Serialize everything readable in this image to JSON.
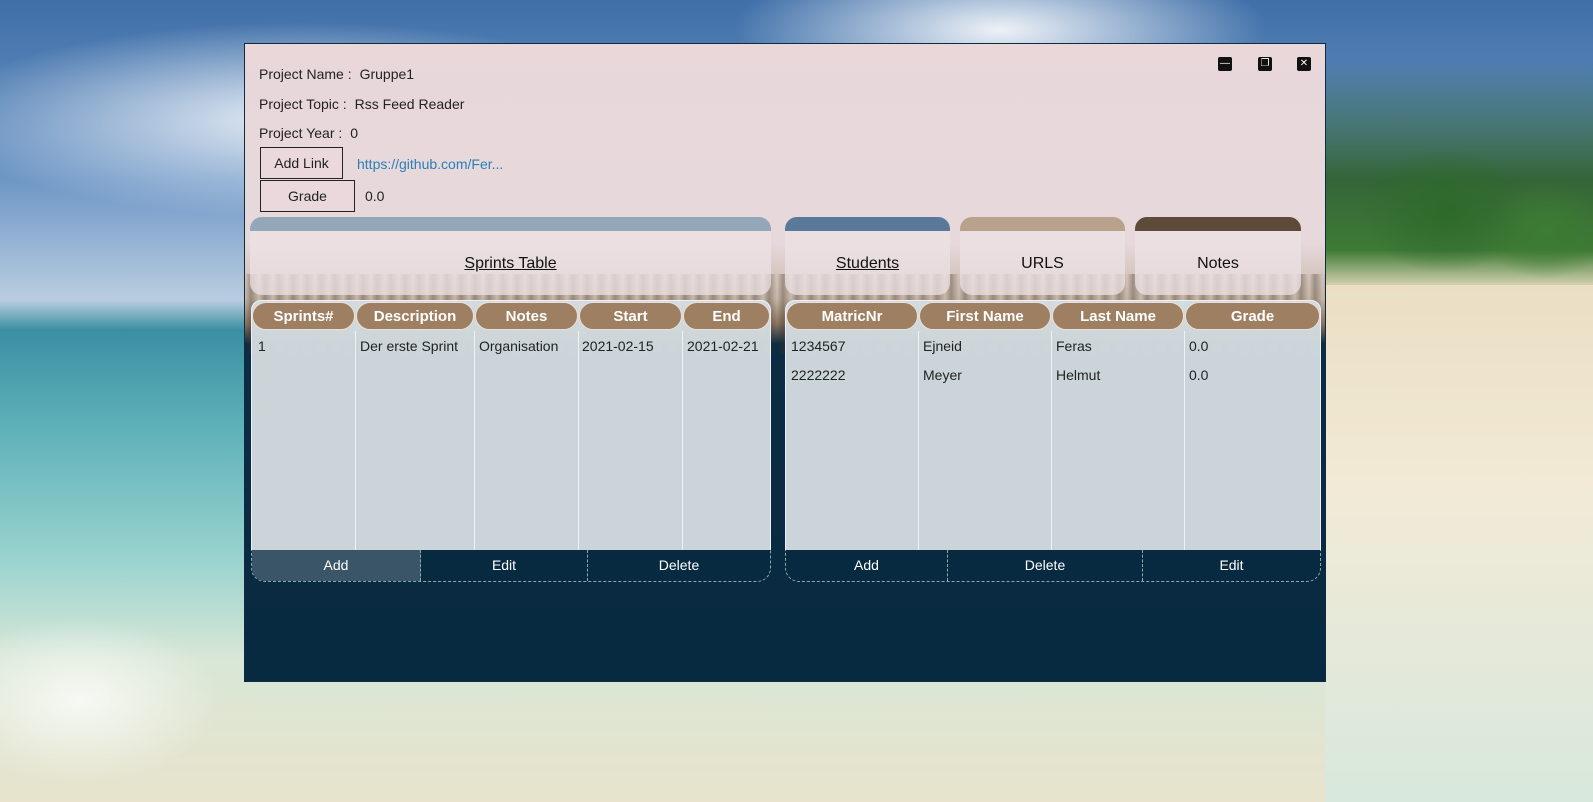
{
  "project": {
    "name_label": "Project Name :",
    "name_value": "Gruppe1",
    "topic_label": "Project Topic :",
    "topic_value": "Rss Feed Reader",
    "year_label": "Project Year :",
    "year_value": "0",
    "add_link_label": "Add Link",
    "link_text": "https://github.com/Fer...",
    "grade_label": "Grade",
    "grade_value": "0.0"
  },
  "tabs": [
    {
      "label": "Sprints Table",
      "strip": "#93a7b8",
      "underline": true
    },
    {
      "label": "Students",
      "strip": "#5a7898",
      "underline": true
    },
    {
      "label": "URLS",
      "strip": "#b9a28c",
      "underline": false
    },
    {
      "label": "Notes",
      "strip": "#5e4a38",
      "underline": false
    }
  ],
  "sprints": {
    "headers": [
      "Sprints#",
      "Description",
      "Notes",
      "Start",
      "End"
    ],
    "rows": [
      [
        "1",
        "Der erste Sprint",
        "Organisation",
        "2021-02-15",
        "2021-02-21"
      ]
    ],
    "buttons": [
      "Add",
      "Edit",
      "Delete"
    ]
  },
  "students": {
    "headers": [
      "MatricNr",
      "First Name",
      "Last Name",
      "Grade"
    ],
    "rows": [
      [
        "1234567",
        "Ejneid",
        "Feras",
        "0.0"
      ],
      [
        "2222222",
        "Meyer",
        "Helmut",
        "0.0"
      ]
    ],
    "buttons": [
      "Add",
      "Delete",
      "Edit"
    ]
  },
  "colors": {
    "header_pill": "#9e7f62",
    "button_bar": "#082a40",
    "active_button": "#3a5568",
    "link": "#2a7fb8"
  }
}
